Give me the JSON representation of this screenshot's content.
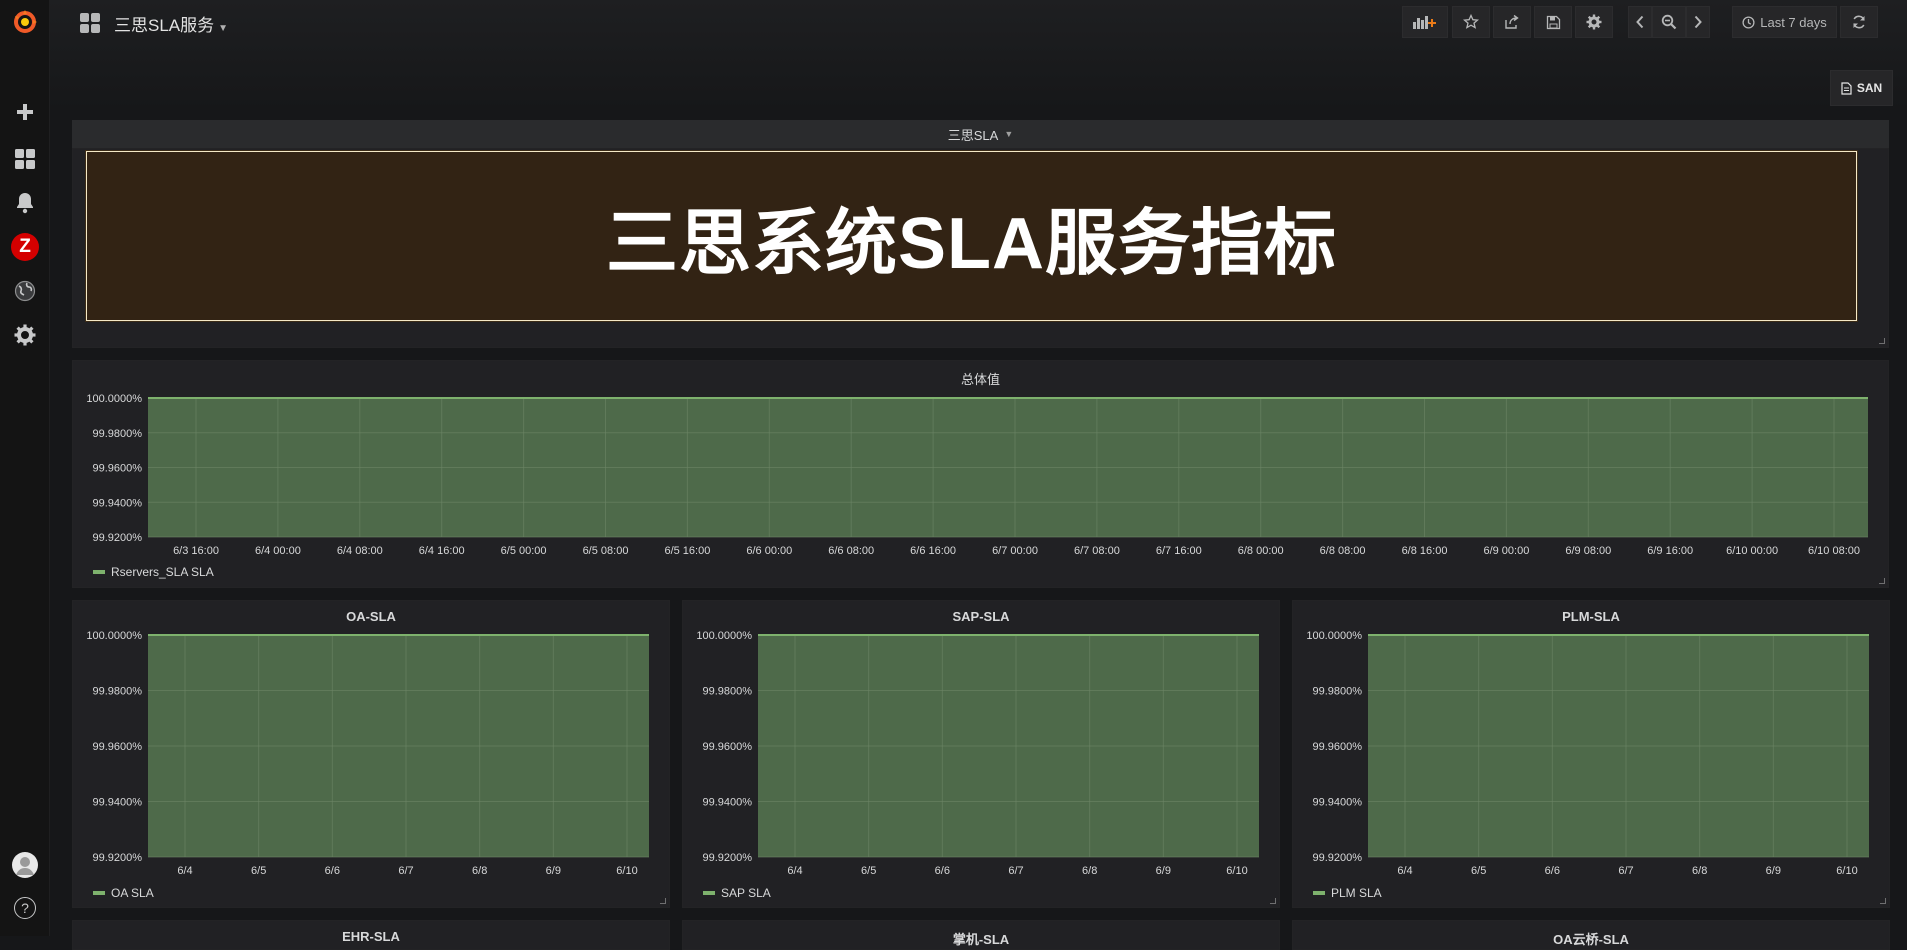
{
  "header": {
    "dashboard_title": "三思SLA服务",
    "time_range": "Last 7 days",
    "san_link": "SAN"
  },
  "sidebar": {
    "icons": [
      "grafana-logo-icon",
      "plus-icon",
      "dashboards-icon",
      "bell-icon",
      "zabbix-icon",
      "globe-icon",
      "gear-icon",
      "avatar-icon",
      "help-icon"
    ],
    "zabbix_letter": "Z",
    "help_glyph": "?"
  },
  "row": {
    "title": "三思SLA"
  },
  "banner": {
    "text": "三思系统SLA服务指标"
  },
  "colors": {
    "series": "#7eb26d",
    "fill": "#4e6a4a",
    "banner_bg": "#322314"
  },
  "chart_data": [
    {
      "type": "area",
      "title": "总体值",
      "x": [
        "6/3 16:00",
        "6/4 00:00",
        "6/4 08:00",
        "6/4 16:00",
        "6/5 00:00",
        "6/5 08:00",
        "6/5 16:00",
        "6/6 00:00",
        "6/6 08:00",
        "6/6 16:00",
        "6/7 00:00",
        "6/7 08:00",
        "6/7 16:00",
        "6/8 00:00",
        "6/8 08:00",
        "6/8 16:00",
        "6/9 00:00",
        "6/9 08:00",
        "6/9 16:00",
        "6/10 00:00",
        "6/10 08:00"
      ],
      "yticks": [
        "100.0000%",
        "99.9800%",
        "99.9600%",
        "99.9400%",
        "99.9200%"
      ],
      "ylim": [
        99.92,
        100.0
      ],
      "series": [
        {
          "name": "Rservers_SLA SLA",
          "value": 100.0
        }
      ],
      "grid": true,
      "legend": "bottom-left"
    },
    {
      "type": "area",
      "title": "OA-SLA",
      "x": [
        "6/4",
        "6/5",
        "6/6",
        "6/7",
        "6/8",
        "6/9",
        "6/10"
      ],
      "yticks": [
        "100.0000%",
        "99.9800%",
        "99.9600%",
        "99.9400%",
        "99.9200%"
      ],
      "ylim": [
        99.92,
        100.0
      ],
      "series": [
        {
          "name": "OA SLA",
          "value": 100.0
        }
      ],
      "grid": true,
      "legend": "bottom-left"
    },
    {
      "type": "area",
      "title": "SAP-SLA",
      "x": [
        "6/4",
        "6/5",
        "6/6",
        "6/7",
        "6/8",
        "6/9",
        "6/10"
      ],
      "yticks": [
        "100.0000%",
        "99.9800%",
        "99.9600%",
        "99.9400%",
        "99.9200%"
      ],
      "ylim": [
        99.92,
        100.0
      ],
      "series": [
        {
          "name": "SAP SLA",
          "value": 100.0
        }
      ],
      "grid": true,
      "legend": "bottom-left"
    },
    {
      "type": "area",
      "title": "PLM-SLA",
      "x": [
        "6/4",
        "6/5",
        "6/6",
        "6/7",
        "6/8",
        "6/9",
        "6/10"
      ],
      "yticks": [
        "100.0000%",
        "99.9800%",
        "99.9600%",
        "99.9400%",
        "99.9200%"
      ],
      "ylim": [
        99.92,
        100.0
      ],
      "series": [
        {
          "name": "PLM SLA",
          "value": 100.0
        }
      ],
      "grid": true,
      "legend": "bottom-left"
    }
  ],
  "bottom_panels": [
    {
      "title": "EHR-SLA"
    },
    {
      "title": "掌机-SLA"
    },
    {
      "title": "OA云桥-SLA"
    }
  ]
}
